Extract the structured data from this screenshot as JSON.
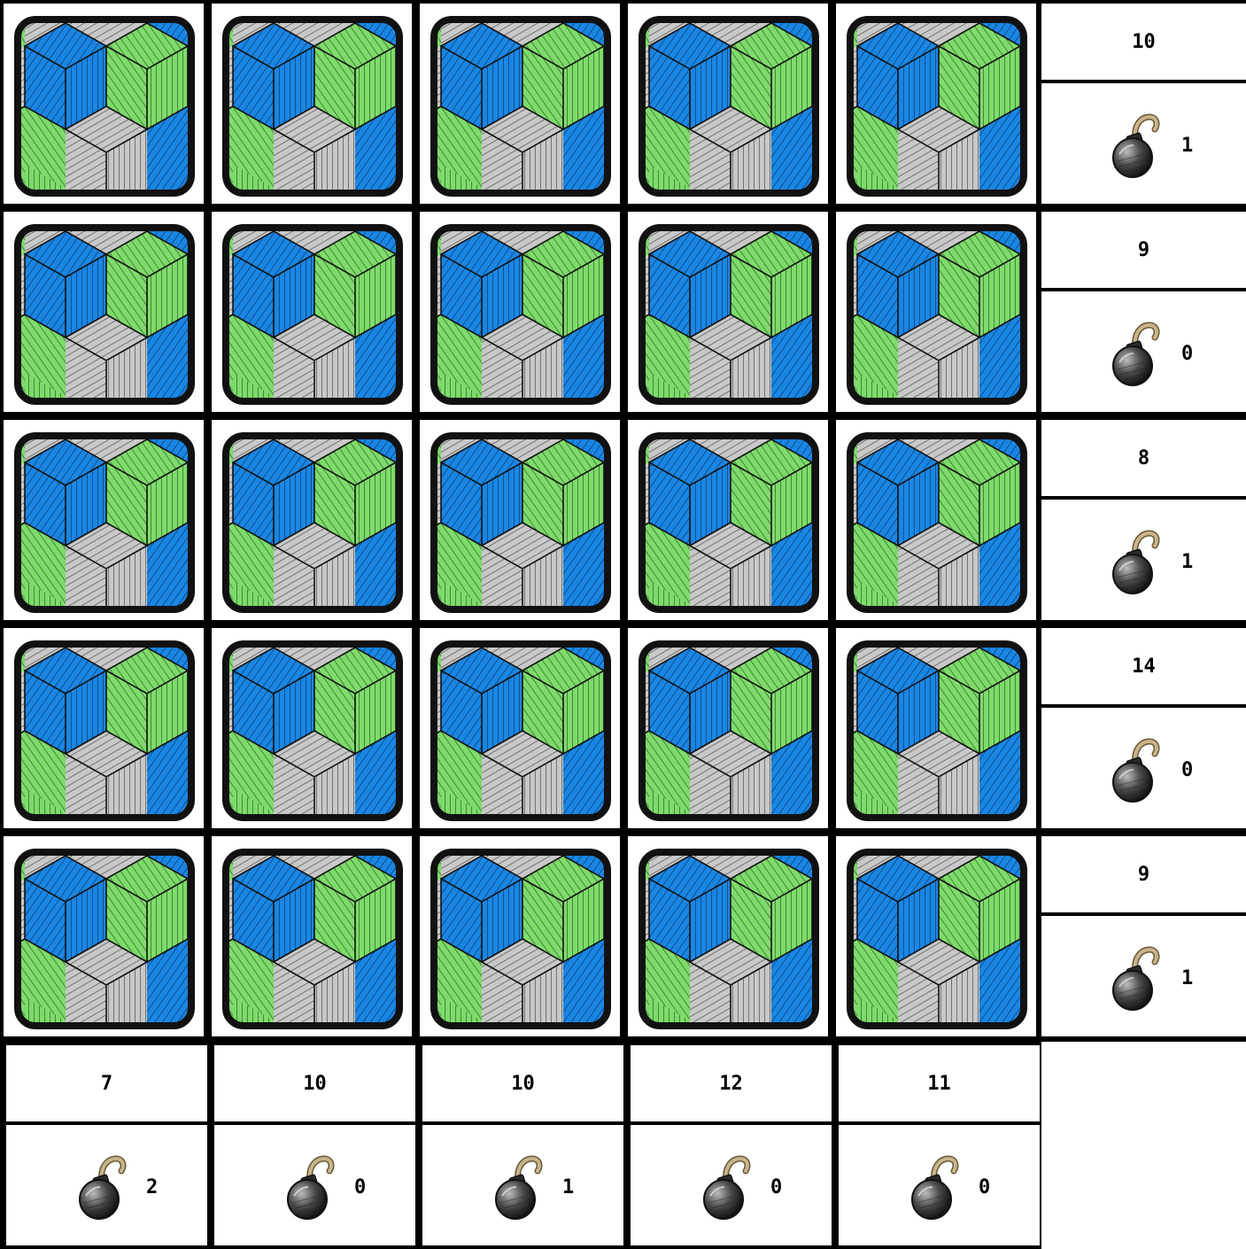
{
  "board": {
    "rows": 5,
    "cols": 5,
    "tile_style": "isometric-cubes",
    "colors": {
      "blue": "#1a86e4",
      "green": "#7edb6b",
      "gray": "#c8c8c8",
      "outline": "#111111",
      "background": "#ffffff"
    }
  },
  "row_hints": [
    {
      "sum": "10",
      "bombs": "1"
    },
    {
      "sum": "9",
      "bombs": "0"
    },
    {
      "sum": "8",
      "bombs": "1"
    },
    {
      "sum": "14",
      "bombs": "0"
    },
    {
      "sum": "9",
      "bombs": "1"
    }
  ],
  "col_hints": [
    {
      "sum": "7",
      "bombs": "2"
    },
    {
      "sum": "10",
      "bombs": "0"
    },
    {
      "sum": "10",
      "bombs": "1"
    },
    {
      "sum": "12",
      "bombs": "0"
    },
    {
      "sum": "11",
      "bombs": "0"
    }
  ],
  "icons": {
    "tile": "cube-pattern-icon",
    "bomb": "bomb-icon"
  }
}
